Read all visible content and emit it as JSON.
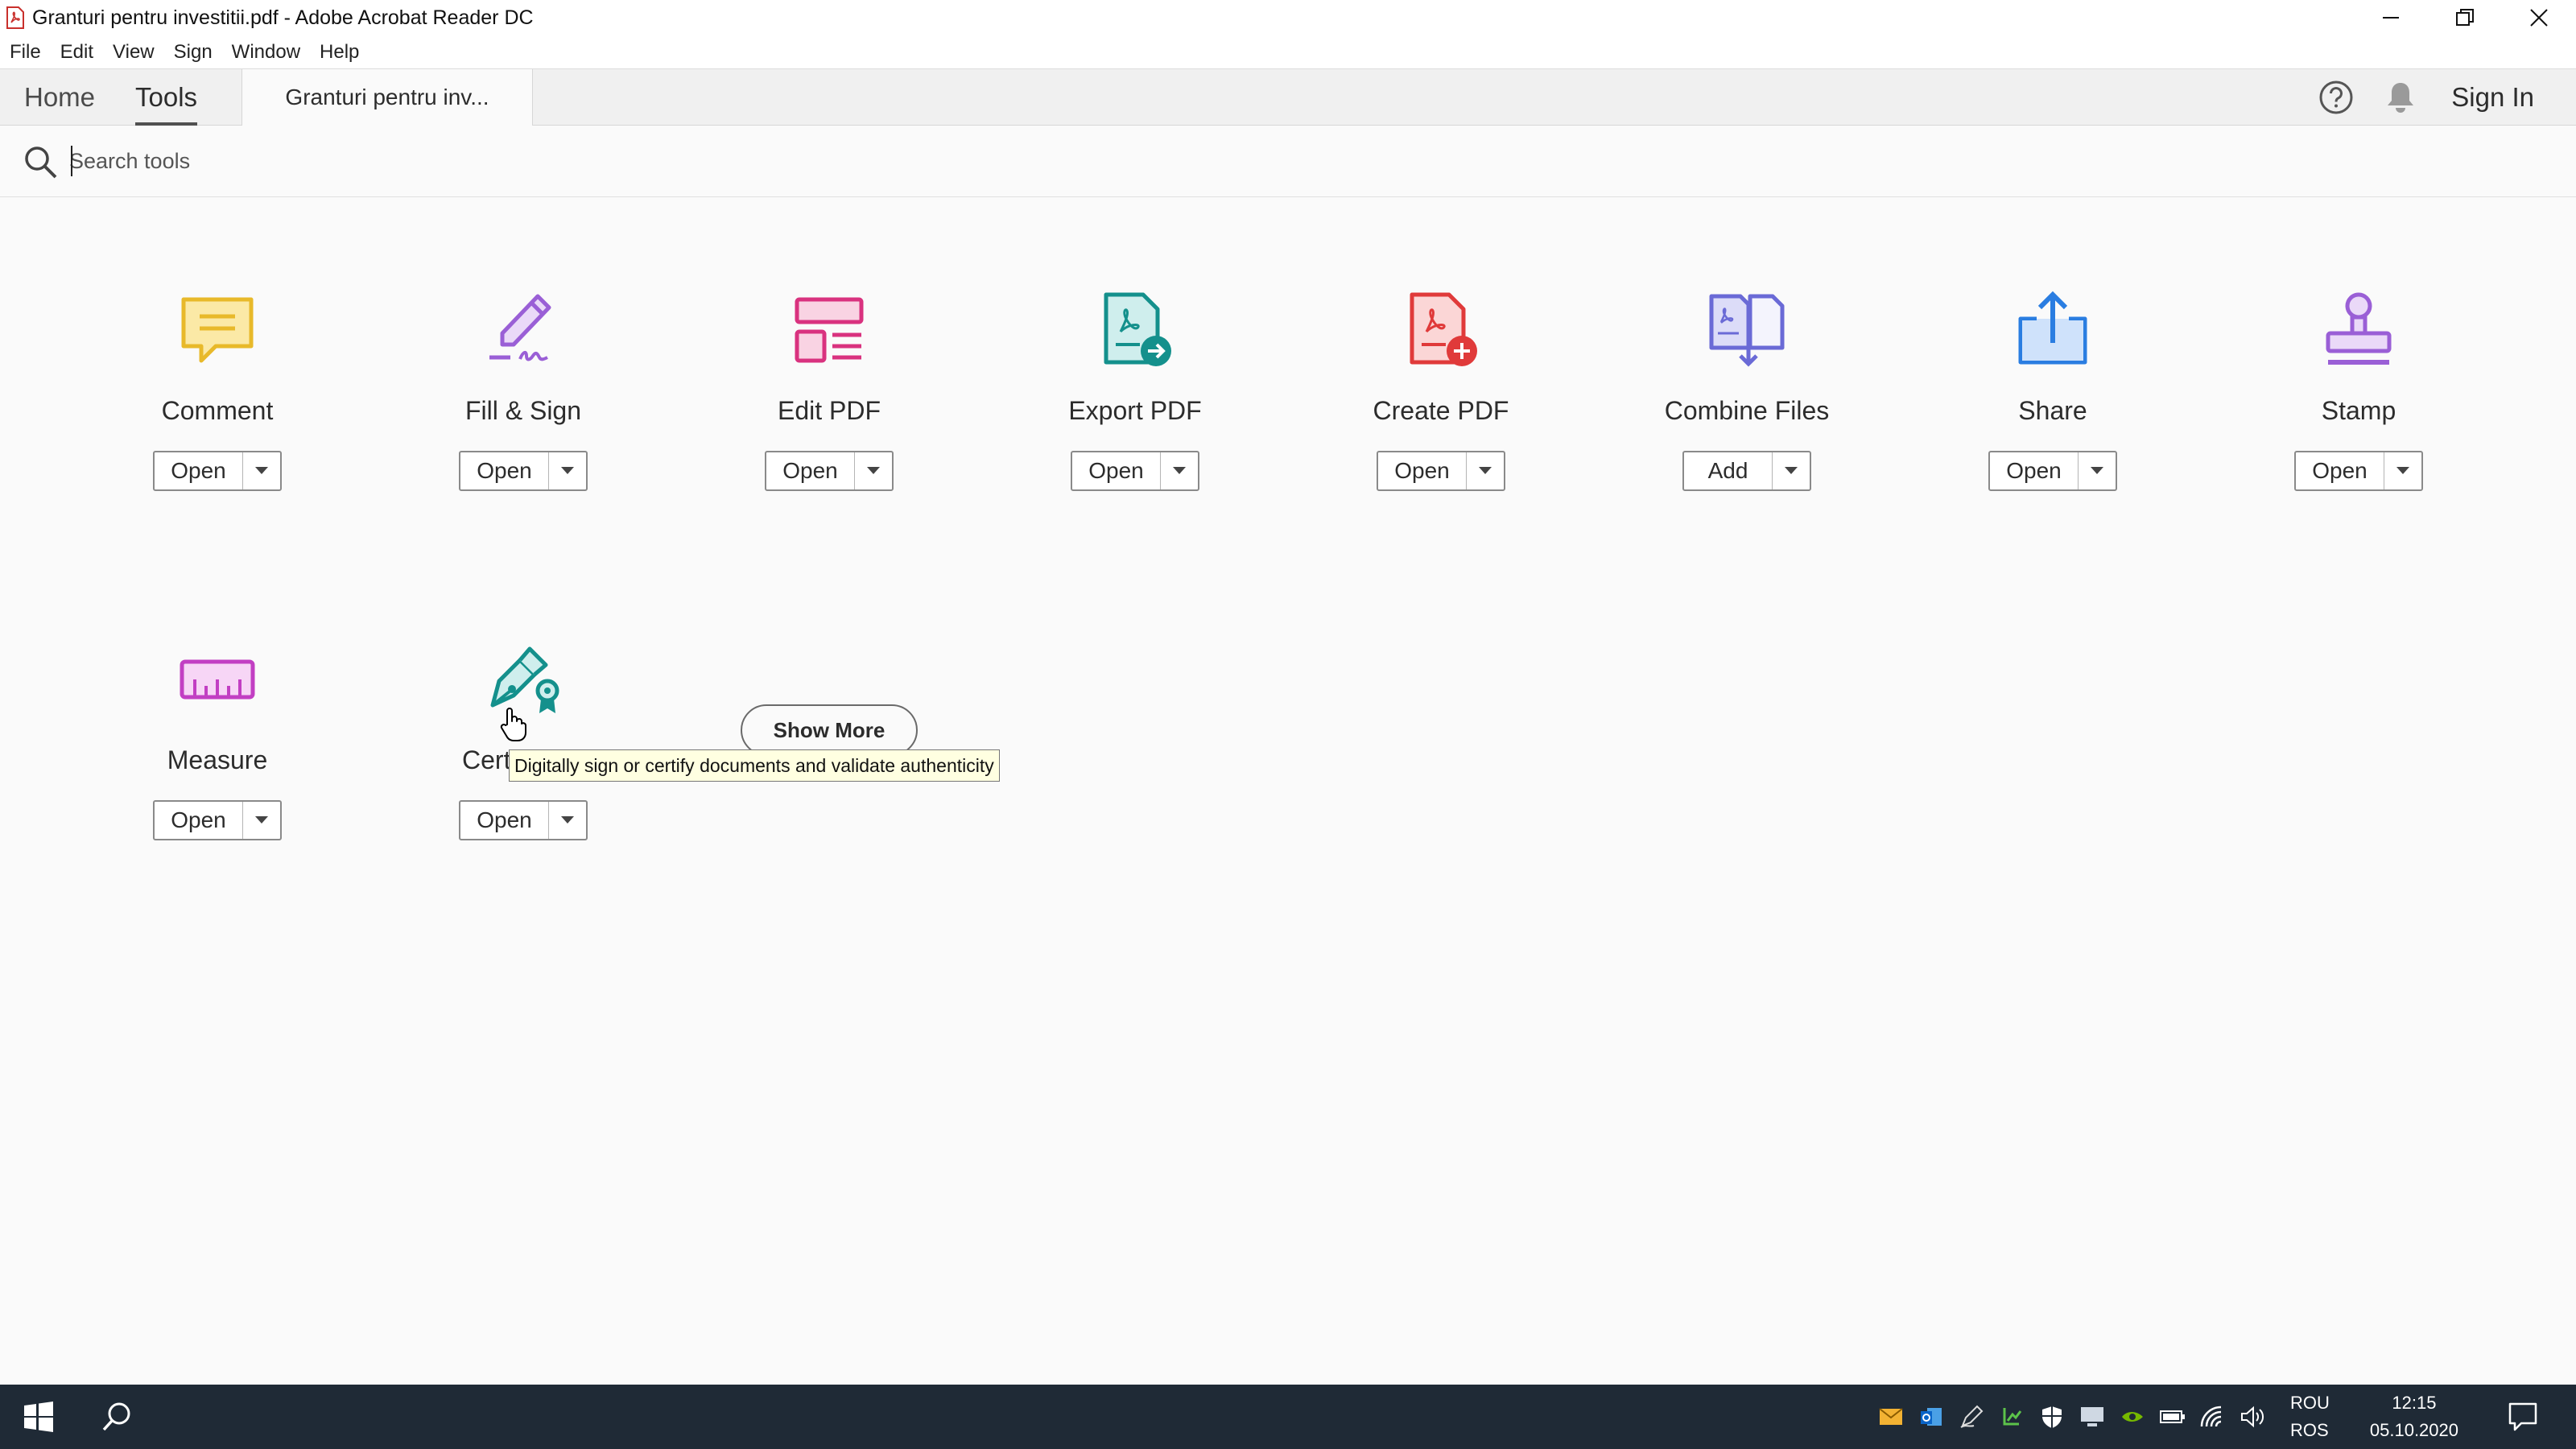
{
  "window": {
    "title": "Granturi pentru investitii.pdf - Adobe Acrobat Reader DC"
  },
  "menu": [
    "File",
    "Edit",
    "View",
    "Sign",
    "Window",
    "Help"
  ],
  "tabs": {
    "home": "Home",
    "tools": "Tools",
    "document": "Granturi pentru inv..."
  },
  "header": {
    "sign_in": "Sign In"
  },
  "search": {
    "placeholder": "Search tools"
  },
  "tools": [
    {
      "label": "Comment",
      "button": "Open",
      "icon": "comment-icon",
      "color": "#e8b92a"
    },
    {
      "label": "Fill & Sign",
      "button": "Open",
      "icon": "fill-sign-icon",
      "color": "#9a5fd6"
    },
    {
      "label": "Edit PDF",
      "button": "Open",
      "icon": "edit-pdf-icon",
      "color": "#d9327f"
    },
    {
      "label": "Export PDF",
      "button": "Open",
      "icon": "export-pdf-icon",
      "color": "#14908c"
    },
    {
      "label": "Create PDF",
      "button": "Open",
      "icon": "create-pdf-icon",
      "color": "#e03a3a"
    },
    {
      "label": "Combine Files",
      "button": "Add",
      "icon": "combine-files-icon",
      "color": "#6a6ad6"
    },
    {
      "label": "Share",
      "button": "Open",
      "icon": "share-icon",
      "color": "#2a7de1"
    },
    {
      "label": "Stamp",
      "button": "Open",
      "icon": "stamp-icon",
      "color": "#9a5fd6"
    },
    {
      "label": "Measure",
      "button": "Open",
      "icon": "measure-icon",
      "color": "#c23fc3"
    },
    {
      "label": "Cert",
      "button": "Open",
      "icon": "certificates-icon",
      "color": "#14908c"
    }
  ],
  "show_more": "Show More",
  "tooltip": "Digitally sign or certify documents and validate authenticity",
  "taskbar": {
    "lang_top": "ROU",
    "lang_bottom": "ROS",
    "time": "12:15",
    "date": "05.10.2020"
  }
}
